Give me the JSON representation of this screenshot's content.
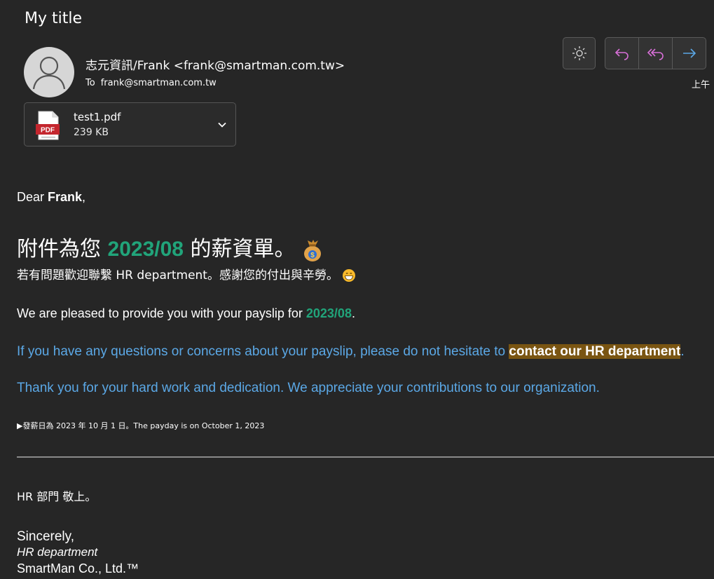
{
  "header": {
    "title": "My title",
    "sender": "志元資訊/Frank <frank@smartman.com.tw>",
    "to_label": "To",
    "to_address": "frank@smartman.com.tw",
    "time": "上午"
  },
  "toolbar": {
    "icons": [
      "sun-icon",
      "reply-icon",
      "reply-all-icon",
      "forward-icon"
    ],
    "colors": {
      "reply": "#d86fd8",
      "forward": "#5ba8e6"
    }
  },
  "attachment": {
    "badge": "PDF",
    "filename": "test1.pdf",
    "size": "239 KB"
  },
  "message": {
    "greeting_prefix": "Dear ",
    "greeting_name": "Frank",
    "greeting_suffix": ",",
    "headline_prefix": "附件為您 ",
    "headline_period": "2023/08",
    "headline_suffix": " 的薪資單。",
    "sub_zh": "若有問題歡迎聯繫 HR department。感謝您的付出與辛勞。",
    "pleased_prefix": "We are pleased to provide you with your payslip for ",
    "pleased_period": "2023/08",
    "pleased_suffix": ".",
    "questions_prefix": "If you have any questions or concerns about your payslip, please do not hesitate to ",
    "questions_highlight": "contact our HR department",
    "questions_suffix": ".",
    "thanks": "Thank you for your hard work and dedication. We appreciate your contributions to our organization.",
    "payday_arrow": "▶",
    "payday": "發薪日為 2023 年 10 月 1 日。The payday is on October 1, 2023",
    "hr_zh": "HR 部門 敬上。",
    "sincerely": "Sincerely,",
    "dept": "HR department",
    "company": "SmartMan Co., Ltd.™"
  },
  "colors": {
    "background": "#262626",
    "accent_green": "#21a47a",
    "link_blue": "#5ba8e6",
    "highlight": "#7a5512"
  }
}
